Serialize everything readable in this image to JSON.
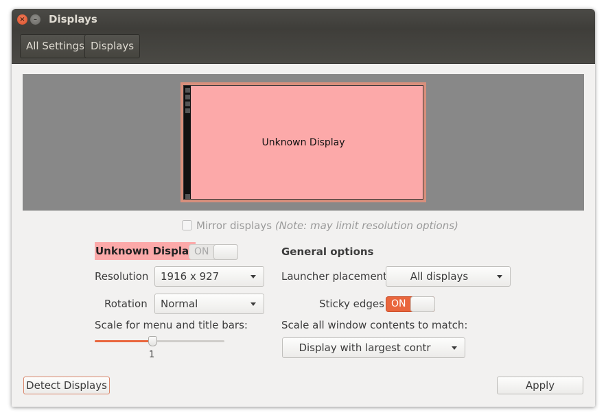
{
  "window": {
    "title": "Displays",
    "controls": {
      "close_icon": "close-icon",
      "minimize_icon": "minimize-icon"
    }
  },
  "breadcrumbs": [
    {
      "label": "All Settings"
    },
    {
      "label": "Displays"
    }
  ],
  "arrangement": {
    "monitor_label": "Unknown Display",
    "monitor_color": "#fca9a9"
  },
  "mirror": {
    "label": "Mirror displays",
    "note": "(Note: may limit resolution options)",
    "checked": false
  },
  "display_panel": {
    "name": "Unknown Display",
    "toggle_label": "ON",
    "resolution_label": "Resolution",
    "resolution_value": "1916 x 927",
    "rotation_label": "Rotation",
    "rotation_value": "Normal",
    "scale_label": "Scale for menu and title bars:",
    "scale_value": "1",
    "scale_fraction": 0.45
  },
  "general": {
    "heading": "General options",
    "launcher_label": "Launcher placement",
    "launcher_value": "All displays",
    "sticky_label": "Sticky edges",
    "sticky_toggle_label": "ON",
    "scale_all_label": "Scale all window contents to match:",
    "scale_all_value": "Display with largest contr"
  },
  "buttons": {
    "detect": "Detect Displays",
    "apply": "Apply"
  },
  "colors": {
    "accent": "#e9663d",
    "titlebar": "#3e3d39",
    "arrangement_bg": "#888888"
  }
}
